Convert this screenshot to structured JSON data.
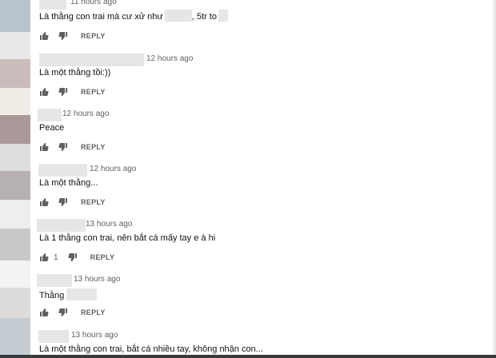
{
  "comments": [
    {
      "time": "11 hours ago",
      "text": "Là thằng con trai mà cư xử như",
      "text_tail": ", 5tr to",
      "likes": "",
      "reply": "REPLY"
    },
    {
      "time": "12 hours ago",
      "text": "Là một thằng tồi:))",
      "text_tail": "",
      "likes": "",
      "reply": "REPLY"
    },
    {
      "time": "12 hours ago",
      "text": "Peace",
      "text_tail": "",
      "likes": "",
      "reply": "REPLY"
    },
    {
      "time": "12 hours ago",
      "text": "Là một thằng...",
      "text_tail": "",
      "likes": "",
      "reply": "REPLY"
    },
    {
      "time": "13 hours ago",
      "text": "Là 1 thằng con trai, nên bắt cá mấy tay e à hi",
      "text_tail": "",
      "likes": "1",
      "reply": "REPLY"
    },
    {
      "time": "13 hours ago",
      "text": "Thằng",
      "text_tail": "",
      "likes": "",
      "reply": "REPLY"
    },
    {
      "time": "13 hours ago",
      "text": "Là một thằng con trai, bắt cá nhiều tay, không nhận con...",
      "text_tail": "",
      "likes": "",
      "reply": ""
    }
  ],
  "icons": {
    "like": "thumbs-up-icon",
    "dislike": "thumbs-down-icon"
  },
  "colors": {
    "text": "#030303",
    "meta": "#606060",
    "redaction": "#e6e6e6"
  }
}
